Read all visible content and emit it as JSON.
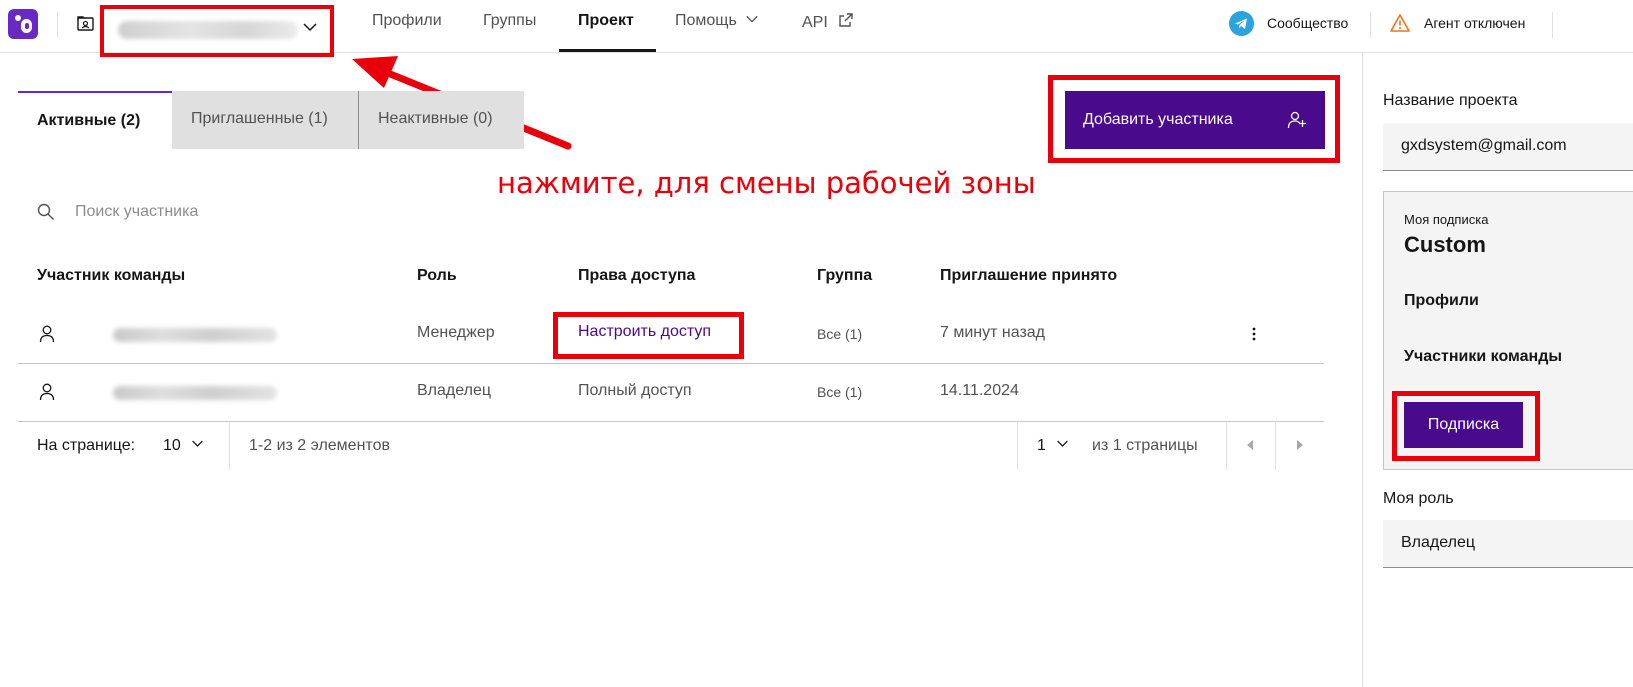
{
  "nav": {
    "items": [
      {
        "label": "Профили"
      },
      {
        "label": "Группы"
      },
      {
        "label": "Проект"
      },
      {
        "label": "Помощь"
      },
      {
        "label": "API"
      }
    ],
    "community": "Сообщество",
    "agent_status": "Агент отключен",
    "active_index": 2
  },
  "tabs": [
    {
      "label": "Активные (2)"
    },
    {
      "label": "Приглашенные (1)"
    },
    {
      "label": "Неактивные (0)"
    }
  ],
  "annotation": {
    "text": "нажмите, для смены рабочей зоны"
  },
  "add_button": {
    "label": "Добавить участника",
    "icon": "add-user-icon"
  },
  "search": {
    "placeholder": "Поиск участника"
  },
  "table": {
    "headers": [
      "Участник команды",
      "Роль",
      "Права доступа",
      "Группа",
      "Приглашение принято"
    ],
    "rows": [
      {
        "role": "Менеджер",
        "access": "Настроить доступ",
        "group": "Все (1)",
        "accepted": "7 минут назад"
      },
      {
        "role": "Владелец",
        "access": "Полный доступ",
        "group": "Все (1)",
        "accepted": "14.11.2024"
      }
    ]
  },
  "pagination": {
    "per_page_label": "На странице:",
    "per_page_value": "10",
    "range_text": "1-2 из 2 элементов",
    "page_value": "1",
    "pages_text": "из 1 страницы"
  },
  "sidebar": {
    "project_name_label": "Название проекта",
    "project_name_value": "gxdsystem@gmail.com",
    "subscription_label": "Моя подписка",
    "plan": "Custom",
    "profiles_label": "Профили",
    "members_label": "Участники команды",
    "subscription_button": "Подписка",
    "role_label": "Моя роль",
    "role_value": "Владелец"
  },
  "colors": {
    "accent": "#4a0a8c",
    "brand": "#6929c4",
    "annotation": "#e8000b",
    "telegram": "#2aa3de"
  }
}
